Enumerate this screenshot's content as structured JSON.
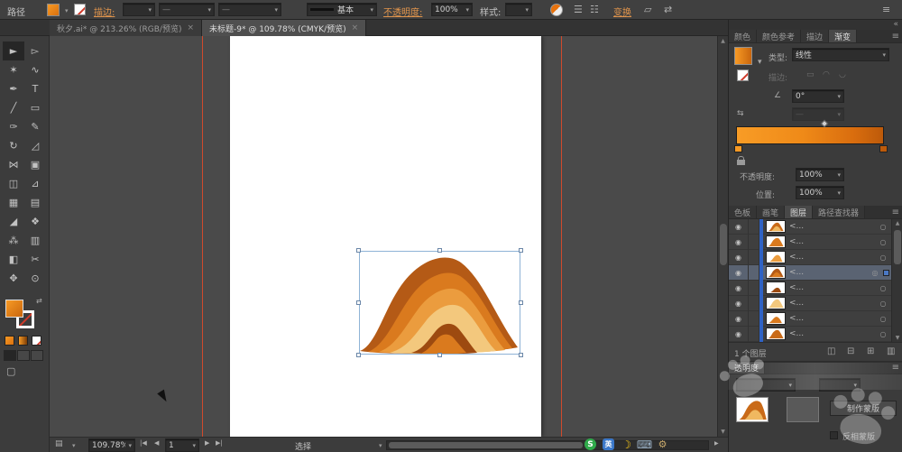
{
  "icons": {
    "caret": "▾",
    "menu": "≡",
    "collapse": "«",
    "scroll_up": "▲",
    "scroll_down": "▼",
    "scroll_left": "◀",
    "scroll_right": "▶",
    "nav_first": "|◀",
    "nav_prev": "◀",
    "nav_next": "▶",
    "nav_last": "▶|",
    "eye": "◉",
    "target": "○",
    "target_selected": "◎",
    "close": "×",
    "angle": "∠",
    "reverse": "⇆",
    "swap": "⇄",
    "align_a": "☰",
    "align_b": "☷",
    "iso_a": "▱",
    "iso_b": "⇄",
    "stroke_btn_a": "▭",
    "stroke_btn_b": "◠",
    "stroke_btn_c": "◡",
    "screen_mode": "▢",
    "page_setup": "▤",
    "moon": "☽",
    "keyboard": "⌨",
    "gear": "⚙"
  },
  "control_bar": {
    "object_type": "路径",
    "stroke_link": "描边:",
    "brush_name": "基本",
    "opacity_link": "不透明度:",
    "opacity_value": "100%",
    "style_label": "样式:",
    "transform_link": "变换"
  },
  "document_tabs": [
    {
      "title": "秋夕.ai* @ 213.26% (RGB/预览)",
      "close": "×"
    },
    {
      "title": "未标题-9* @ 109.78% (CMYK/预览)",
      "close": "×"
    }
  ],
  "tools": [
    {
      "name": "selection",
      "glyph": "►"
    },
    {
      "name": "direct-selection",
      "glyph": "▻"
    },
    {
      "name": "magic-wand",
      "glyph": "✶"
    },
    {
      "name": "lasso",
      "glyph": "∿"
    },
    {
      "name": "pen",
      "glyph": "✒"
    },
    {
      "name": "type",
      "glyph": "T"
    },
    {
      "name": "line-segment",
      "glyph": "╱"
    },
    {
      "name": "rectangle",
      "glyph": "▭"
    },
    {
      "name": "paintbrush",
      "glyph": "✑"
    },
    {
      "name": "pencil",
      "glyph": "✎"
    },
    {
      "name": "rotate",
      "glyph": "↻"
    },
    {
      "name": "scale",
      "glyph": "◿"
    },
    {
      "name": "width",
      "glyph": "⋈"
    },
    {
      "name": "free-transform",
      "glyph": "▣"
    },
    {
      "name": "shape-builder",
      "glyph": "◫"
    },
    {
      "name": "perspective-grid",
      "glyph": "⊿"
    },
    {
      "name": "mesh",
      "glyph": "▦"
    },
    {
      "name": "gradient",
      "glyph": "▤"
    },
    {
      "name": "eyedropper",
      "glyph": "◢"
    },
    {
      "name": "blend",
      "glyph": "❖"
    },
    {
      "name": "symbol-sprayer",
      "glyph": "⁂"
    },
    {
      "name": "column-graph",
      "glyph": "▥"
    },
    {
      "name": "artboard",
      "glyph": "◧"
    },
    {
      "name": "slice",
      "glyph": "✂"
    },
    {
      "name": "hand",
      "glyph": "✥"
    },
    {
      "name": "zoom",
      "glyph": "⊙"
    }
  ],
  "panel_group_top": {
    "tabs": [
      "颜色",
      "颜色参考",
      "描边",
      "渐变"
    ]
  },
  "gradient_panel": {
    "type_label": "类型:",
    "type_value": "线性",
    "stroke_label": "描边:",
    "angle_value": "0°",
    "opacity_label": "不透明度:",
    "opacity_value": "100%",
    "location_label": "位置:",
    "location_value": "100%"
  },
  "panel_group_mid": {
    "tabs": [
      "色板",
      "画笔",
      "图层",
      "路径查找器"
    ]
  },
  "layers_panel": {
    "rows": [
      {
        "label": "<..."
      },
      {
        "label": "<..."
      },
      {
        "label": "<..."
      },
      {
        "label": "<..."
      },
      {
        "label": "<..."
      },
      {
        "label": "<..."
      },
      {
        "label": "<..."
      },
      {
        "label": "<..."
      }
    ],
    "footer_count": "1 个图层",
    "footer_icons": [
      {
        "name": "make-clip-mask",
        "glyph": "◫"
      },
      {
        "name": "new-sublayer",
        "glyph": "⊟"
      },
      {
        "name": "new-layer",
        "glyph": "⊞"
      },
      {
        "name": "delete-layer",
        "glyph": "▥"
      }
    ]
  },
  "transparency_panel": {
    "tab": "透明度",
    "make_mask_button": "制作蒙版",
    "invert_mask_label": "反相蒙版"
  },
  "status_bar": {
    "zoom": "109.78%",
    "artboard_number": "1",
    "current_tool": "选择"
  },
  "ime_bar": {
    "items": [
      {
        "name": "sogou-input",
        "glyph": "S"
      },
      {
        "name": "language-english",
        "glyph": "英"
      },
      {
        "name": "night-mode",
        "glyph": "☽"
      },
      {
        "name": "soft-keyboard",
        "glyph": "⌨"
      },
      {
        "name": "ime-toolbox",
        "glyph": "⚙"
      }
    ]
  },
  "artwork": {
    "band_colors": [
      "#b45a16",
      "#da7a1e",
      "#eb9c3e",
      "#f3c87d",
      "#9d4a10",
      "#da7a1e"
    ],
    "guide_color": "#cf4a2c",
    "selection_color": "#8fb3d6"
  }
}
